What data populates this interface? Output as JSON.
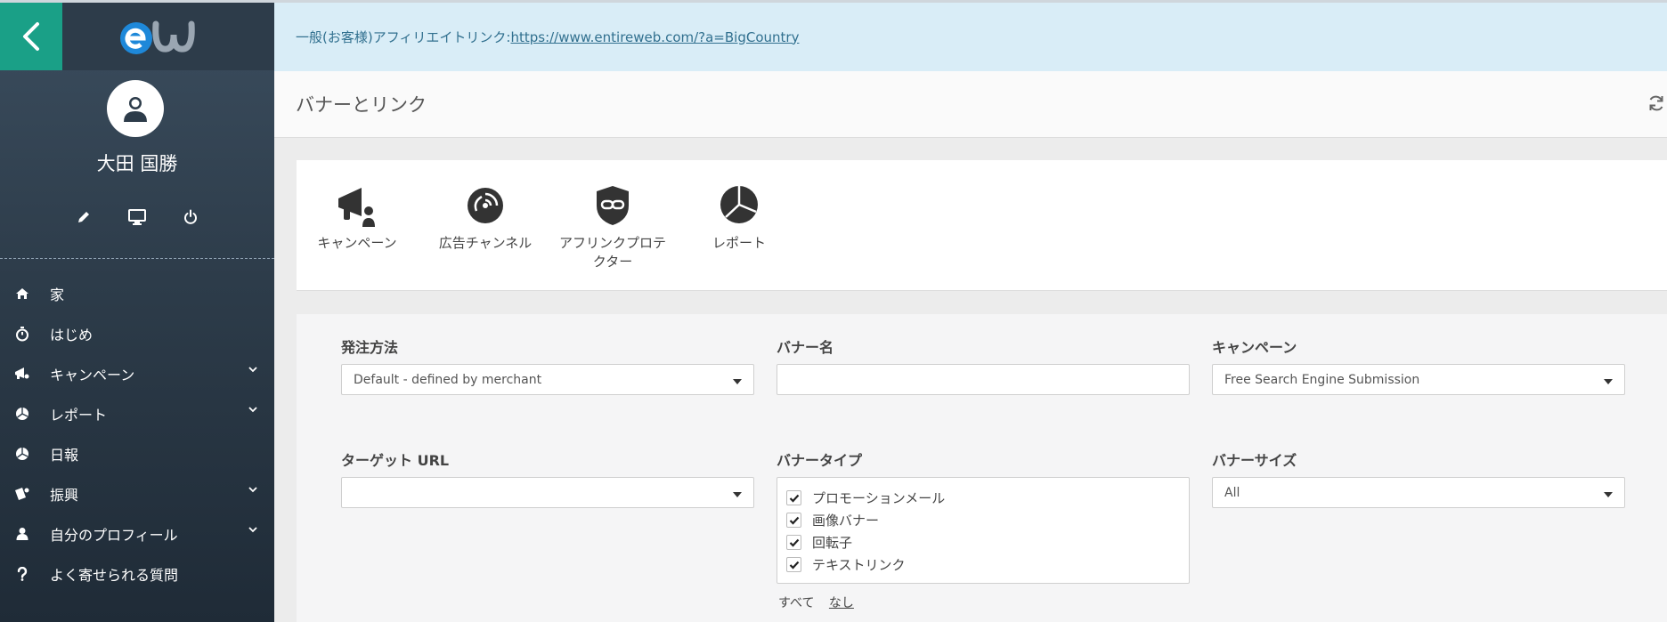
{
  "banner": {
    "prefix": "一般(お客様)アフィリエイトリンク:",
    "url": "https://www.entireweb.com/?a=BigCountry"
  },
  "user": {
    "name": "大田 国勝"
  },
  "nav": [
    {
      "label": "家",
      "icon": "home-icon",
      "expandable": false
    },
    {
      "label": "はじめ",
      "icon": "stopwatch-icon",
      "expandable": false
    },
    {
      "label": "キャンペーン",
      "icon": "megaphone-icon",
      "expandable": true
    },
    {
      "label": "レポート",
      "icon": "pie-chart-icon",
      "expandable": true
    },
    {
      "label": "日報",
      "icon": "pie-chart-icon",
      "expandable": false
    },
    {
      "label": "振興",
      "icon": "promotion-icon",
      "expandable": true
    },
    {
      "label": "自分のプロフィール",
      "icon": "user-icon",
      "expandable": true
    },
    {
      "label": "よく寄せられる質問",
      "icon": "question-icon",
      "expandable": false
    }
  ],
  "page": {
    "title": "バナーとリンク"
  },
  "tiles": [
    {
      "label": "キャンペーン",
      "icon": "megaphone-icon"
    },
    {
      "label": "広告チャンネル",
      "icon": "satellite-dish-icon"
    },
    {
      "label": "アフリンクプロテクター",
      "icon": "link-shield-icon"
    },
    {
      "label": "レポート",
      "icon": "pie-chart-icon"
    }
  ],
  "filters": {
    "order_method": {
      "label": "発注方法",
      "value": "Default - defined by merchant"
    },
    "banner_name": {
      "label": "バナー名",
      "value": ""
    },
    "campaign": {
      "label": "キャンペーン",
      "value": "Free Search Engine Submission"
    },
    "target_url": {
      "label": "ターゲット URL",
      "value": ""
    },
    "banner_type": {
      "label": "バナータイプ",
      "options": [
        {
          "label": "プロモーションメール",
          "checked": true
        },
        {
          "label": "画像バナー",
          "checked": true
        },
        {
          "label": "回転子",
          "checked": true
        },
        {
          "label": "テキストリンク",
          "checked": true
        }
      ],
      "select_all": "すべて",
      "select_none": "なし"
    },
    "banner_size": {
      "label": "バナーサイズ",
      "value": "All"
    }
  },
  "colors": {
    "accent": "#1aa087",
    "sidebar": "#2d3c4a",
    "banner_bg": "#d9edf7",
    "banner_text": "#31708f"
  }
}
